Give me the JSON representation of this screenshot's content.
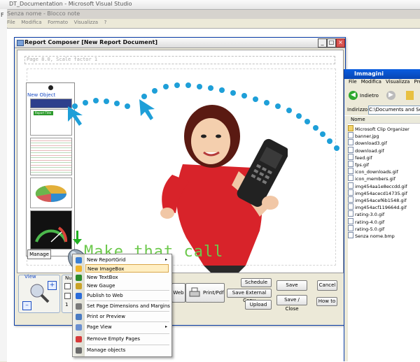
{
  "vs": {
    "title": "DT_Documentation - Microsoft Visual Studio",
    "left_letter": "F"
  },
  "notepad": {
    "title": "Senza nome - Blocco note",
    "menu": [
      "File",
      "Modifica",
      "Formato",
      "Visualizza",
      "?"
    ]
  },
  "composer": {
    "title": "Report Composer [New Report Document]",
    "ruler": "Page 8.0, Scale factor 1",
    "new_object_label": "New Object",
    "report_title_thumb": "Report Title",
    "manage_label": "Manage",
    "slogan": "Make that call",
    "view_label": "View",
    "plus": "+",
    "minus": "–",
    "num_label": "Num",
    "num_value": "1",
    "web_label": "Web",
    "print_label": "Print/Pdf",
    "buttons": {
      "schedule": "Schedule",
      "save_external": "Save External Copy",
      "upload": "Upload",
      "save": "Save",
      "save_close": "Save / Close",
      "cancel": "Cancel",
      "how_to": "How to"
    }
  },
  "context_menu": {
    "items": [
      {
        "label": "New ReportGrid",
        "submenu": true
      },
      {
        "label": "New ImageBox",
        "highlighted": true
      },
      {
        "label": "New TextBox"
      },
      {
        "label": "New Gauge"
      },
      {
        "label": "Publish to Web"
      },
      {
        "label": "Set Page Dimensions and Margins"
      },
      {
        "label": "Print or Preview"
      },
      {
        "label": "Page View",
        "submenu": true
      },
      {
        "label": "Remove Empty Pages"
      },
      {
        "label": "Manage objects"
      }
    ],
    "arrow": "▸"
  },
  "explorer": {
    "title": "Immagini",
    "menu": [
      "File",
      "Modifica",
      "Visualizza",
      "Preferiti"
    ],
    "back_label": "Indietro",
    "address_label": "Indirizzo",
    "address_value": "C:\\Documents and Settings",
    "column_name": "Nome",
    "files": [
      {
        "name": "Microsoft Clip Organizer",
        "folder": true
      },
      {
        "name": "banner.jpg"
      },
      {
        "name": "download3.gif"
      },
      {
        "name": "download.gif"
      },
      {
        "name": "feed.gif"
      },
      {
        "name": "fps.gif"
      },
      {
        "name": "icon_downloads.gif"
      },
      {
        "name": "icon_members.gif"
      },
      {
        "name": "img454aa1e8eccdd.gif"
      },
      {
        "name": "img454acecd14735.gif"
      },
      {
        "name": "img454acef6b1548.gif"
      },
      {
        "name": "img454acf119664d.gif"
      },
      {
        "name": "rating-3.0.gif"
      },
      {
        "name": "rating-4.0.gif"
      },
      {
        "name": "rating-5.0.gif"
      },
      {
        "name": "Senza nome.bmp"
      }
    ]
  },
  "colors": {
    "accent_blue": "#1e9fd8",
    "slogan_green": "#6cc94c",
    "window_border": "#0b3ea8",
    "menu_highlight": "#ffeec2"
  }
}
